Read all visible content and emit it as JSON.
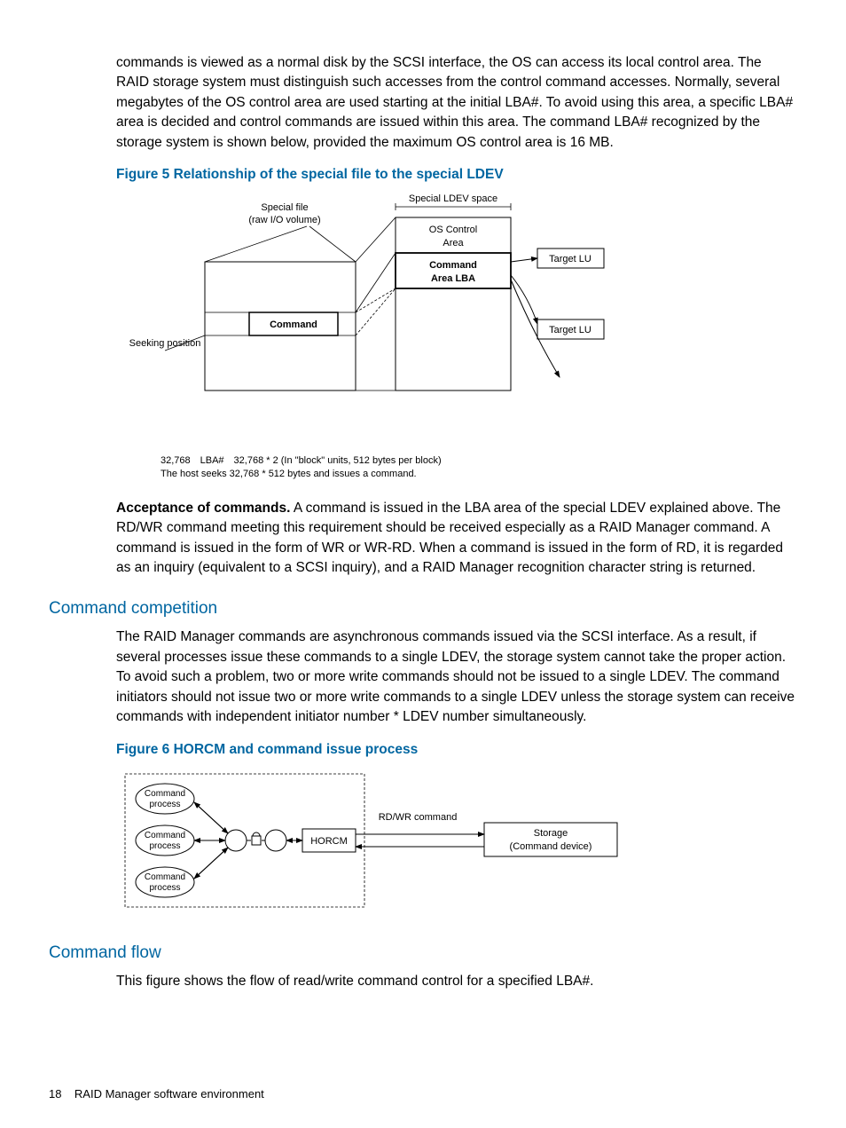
{
  "paragraphs": {
    "p1": "commands is viewed as a normal disk by the SCSI interface, the OS can access its local control area. The RAID storage system must distinguish such accesses from the control command accesses. Normally, several megabytes of the OS control area are used starting at the initial LBA#. To avoid using this area, a specific LBA# area is decided and control commands are issued within this area. The command LBA# recognized by the storage system is shown below, provided the maximum OS control area is 16 MB.",
    "p2_lead": "Acceptance of commands.",
    "p2": " A command is issued in the LBA area of the special LDEV explained above. The RD/WR command meeting this requirement should be received especially as a RAID Manager command. A command is issued in the form of WR or WR-RD. When a command is issued in the form of RD, it is regarded as an inquiry (equivalent to a SCSI inquiry), and a RAID Manager recognition character string is returned.",
    "p3": "The RAID Manager commands are asynchronous commands issued via the SCSI interface. As a result, if several processes issue these commands to a single LDEV, the storage system cannot take the proper action. To avoid such a problem, two or more write commands should not be issued to a single LDEV. The command initiators should not issue two or more write commands to a single LDEV unless the storage system can receive commands with independent initiator number * LDEV number simultaneously.",
    "p4": "This figure shows the flow of read/write command control for a specified LBA#."
  },
  "headings": {
    "h1": "Command competition",
    "h2": "Command flow"
  },
  "figures": {
    "f5_title": "Figure 5 Relationship of the special file to the special LDEV",
    "f6_title": "Figure 6 HORCM and command issue process",
    "f5_caption_line1": "32,768 LBA# 32,768 * 2 (In \"block\" units, 512 bytes per block)",
    "f5_caption_line2": "The host seeks 32,768 * 512 bytes and issues a command."
  },
  "fig5": {
    "special_ldev_space": "Special LDEV space",
    "special_file": "Special file",
    "raw_io": "(raw I/O volume)",
    "os_control": "OS Control",
    "area": "Area",
    "command_area": "Command",
    "area_lba": "Area LBA",
    "target_lu": "Target LU",
    "command": "Command",
    "seeking": "Seeking position"
  },
  "fig6": {
    "cmd_proc": "Command",
    "process": "process",
    "horcm": "HORCM",
    "rdwr": "RD/WR command",
    "storage": "Storage",
    "cmd_device": "(Command device)"
  },
  "footer": {
    "page_num": "18",
    "chapter": "RAID Manager software environment"
  }
}
